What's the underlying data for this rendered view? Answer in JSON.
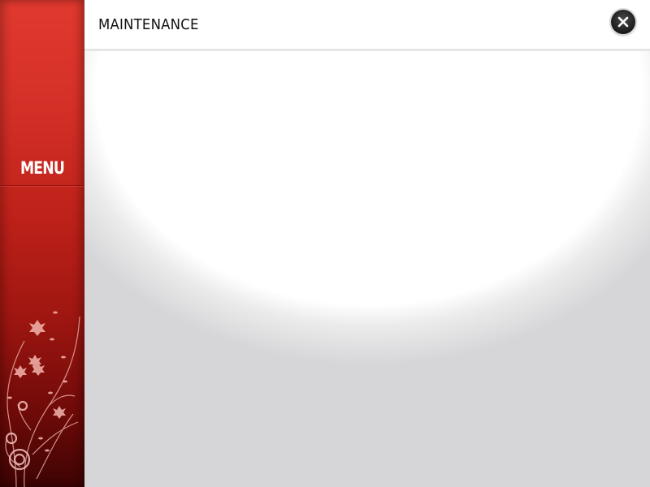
{
  "sidebar": {
    "menu_label": "MENU"
  },
  "header": {
    "title": "MAINTENANCE"
  },
  "icons": {
    "close": "close-icon",
    "decoration": "floral-icon"
  },
  "colors": {
    "sidebar_red": "#c8241c",
    "background_gray": "#d6d6d8",
    "close_button": "#1a1a1a"
  }
}
